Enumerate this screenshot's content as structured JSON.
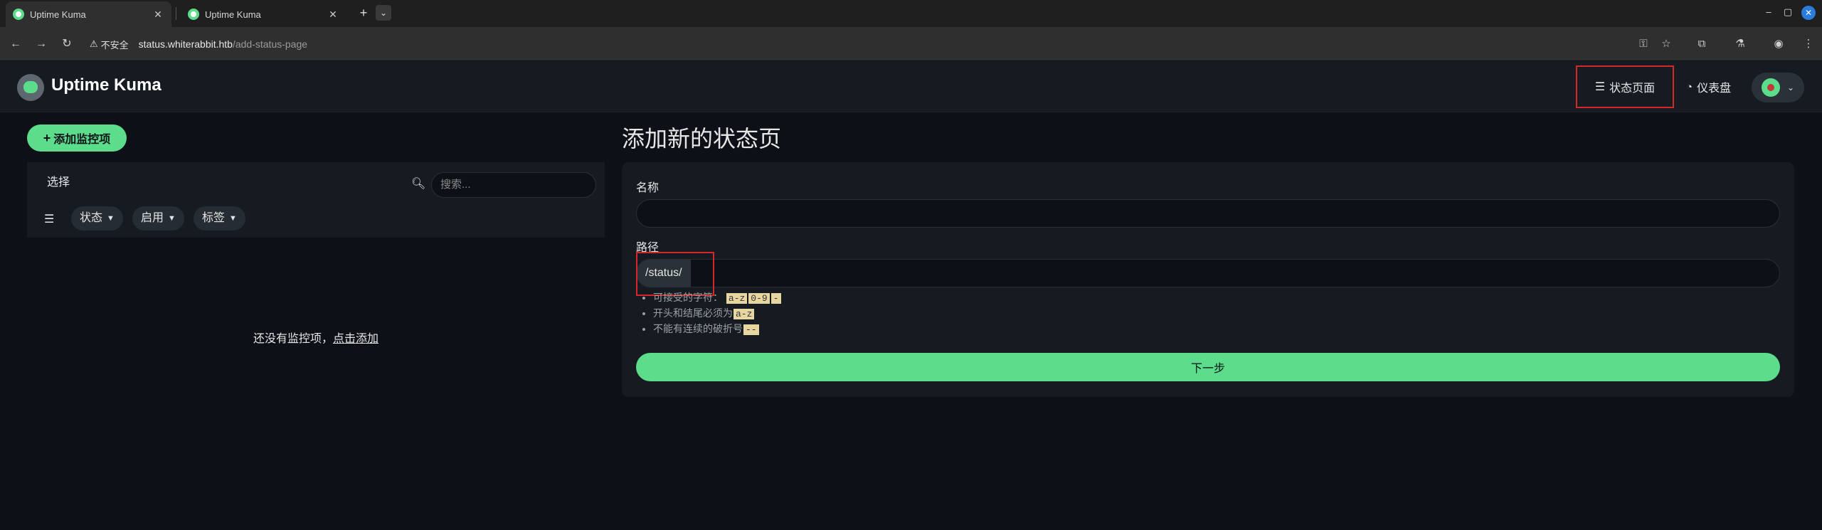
{
  "browser": {
    "tabs": [
      {
        "label": "Uptime Kuma",
        "active": true
      },
      {
        "label": "Uptime Kuma",
        "active": false
      }
    ],
    "new_tab": "+",
    "tab_menu": "⌄",
    "window_controls": {
      "minimize": "–",
      "maximize": "▢",
      "close": "✕"
    },
    "nav": {
      "back": "←",
      "forward": "→",
      "reload": "↻"
    },
    "security_label": "不安全",
    "url_host": "status.whiterabbit.htb",
    "url_path": "/add-status-page"
  },
  "header": {
    "brand": "Uptime Kuma",
    "nav_status_pages": "状态页面",
    "nav_dashboard": "仪表盘"
  },
  "left": {
    "add_monitor": "添加监控项",
    "select": "选择",
    "search_placeholder": "搜索...",
    "filters": [
      "状态",
      "启用",
      "标签"
    ],
    "empty_text": "还没有监控项，",
    "empty_link": "点击添加"
  },
  "main": {
    "title": "添加新的状态页",
    "name_label": "名称",
    "name_value": "",
    "path_label": "路径",
    "path_prefix": "/status/",
    "path_value": "",
    "hints": {
      "allowed": "可接受的字符：",
      "allowed_codes": [
        "a-z",
        "0-9",
        "-"
      ],
      "start_end": "开头和结尾必须为",
      "start_end_code": "a-z",
      "no_double": "不能有连续的破折号",
      "no_double_code": "--"
    },
    "next_button": "下一步"
  },
  "colors": {
    "accent": "#5cdd8b",
    "background": "#0d1117",
    "card": "#161b22",
    "highlight_box": "#d62828"
  }
}
